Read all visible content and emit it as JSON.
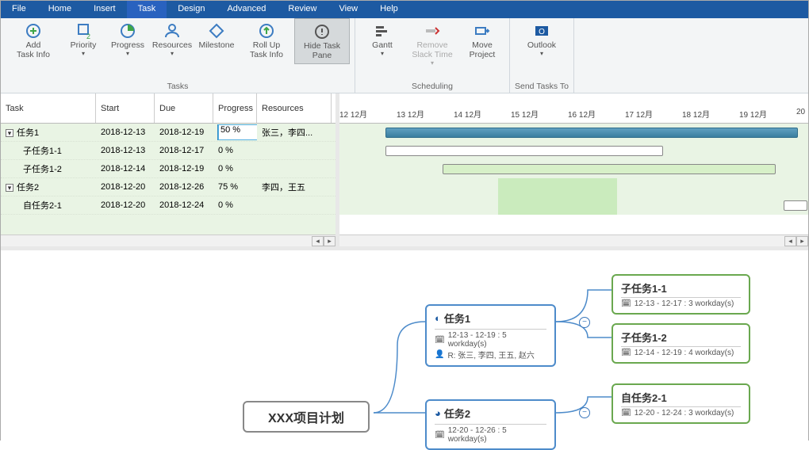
{
  "tabs": {
    "items": [
      "File",
      "Home",
      "Insert",
      "Task",
      "Design",
      "Advanced",
      "Review",
      "View",
      "Help"
    ],
    "active": 3
  },
  "ribbon": {
    "tasks": {
      "label": "Tasks",
      "btns": {
        "add_task_info": "Add\nTask Info",
        "priority": "Priority",
        "progress": "Progress",
        "resources": "Resources",
        "milestone": "Milestone",
        "roll_up": "Roll Up\nTask Info",
        "hide_pane": "Hide Task\nPane"
      }
    },
    "scheduling": {
      "label": "Scheduling",
      "btns": {
        "gantt": "Gantt",
        "remove_slack": "Remove\nSlack Time",
        "move_project": "Move\nProject"
      }
    },
    "send": {
      "label": "Send Tasks To",
      "btns": {
        "outlook": "Outlook"
      }
    }
  },
  "grid": {
    "headers": {
      "task": "Task",
      "start": "Start",
      "due": "Due",
      "progress": "Progress",
      "resources": "Resources"
    },
    "rows": [
      {
        "task": "任务1",
        "start": "2018-12-13",
        "due": "2018-12-19",
        "progress": "50 %",
        "res": "张三，李四...",
        "level": 0,
        "hasChildren": true
      },
      {
        "task": "子任务1-1",
        "start": "2018-12-13",
        "due": "2018-12-17",
        "progress": "0 %",
        "res": "",
        "level": 1
      },
      {
        "task": "子任务1-2",
        "start": "2018-12-14",
        "due": "2018-12-19",
        "progress": "0 %",
        "res": "",
        "level": 1
      },
      {
        "task": "任务2",
        "start": "2018-12-20",
        "due": "2018-12-26",
        "progress": "75 %",
        "res": "李四，王五",
        "level": 0,
        "hasChildren": true
      },
      {
        "task": "自任务2-1",
        "start": "2018-12-20",
        "due": "2018-12-24",
        "progress": "0 %",
        "res": "",
        "level": 1
      }
    ]
  },
  "gantt": {
    "ticks": [
      "12 12月",
      "13 12月",
      "14 12月",
      "15 12月",
      "16 12月",
      "17 12月",
      "18 12月",
      "19 12月",
      "20"
    ]
  },
  "mindmap": {
    "root": "XXX项目计划",
    "task1": {
      "title": "任务1",
      "dates": "12-13 - 12-19 : 5 workday(s)",
      "res": "R: 张三, 李四, 王五, 赵六"
    },
    "task2": {
      "title": "任务2",
      "dates": "12-20 - 12-26 : 5 workday(s)"
    },
    "sub11": {
      "title": "子任务1-1",
      "dates": "12-13 - 12-17 : 3 workday(s)"
    },
    "sub12": {
      "title": "子任务1-2",
      "dates": "12-14 - 12-19 : 4 workday(s)"
    },
    "sub21": {
      "title": "自任务2-1",
      "dates": "12-20 - 12-24 : 3 workday(s)"
    }
  }
}
